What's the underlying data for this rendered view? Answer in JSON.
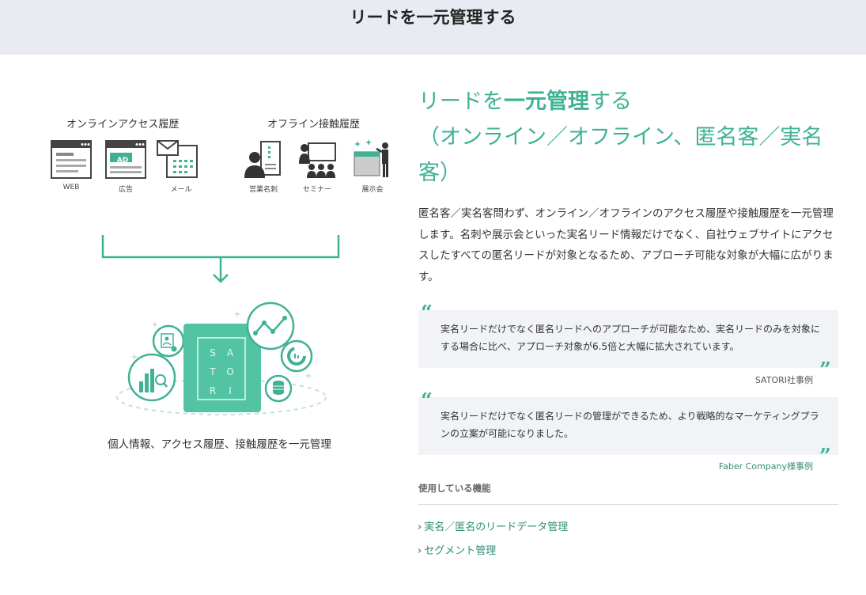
{
  "page": {
    "section_title": "リードを一元管理する"
  },
  "illustration": {
    "online_title": "オンラインアクセス履歴",
    "offline_title": "オフライン接触履歴",
    "online_items": [
      "WEB",
      "広告",
      "メール"
    ],
    "offline_items": [
      "営業名刺",
      "セミナー",
      "展示会"
    ],
    "ad_label": "AD",
    "logo_letters": [
      "S",
      "A",
      "T",
      "O",
      "R",
      "I"
    ],
    "caption": "個人情報、アクセス履歴、接触履歴を一元管理"
  },
  "content": {
    "headline_part1": "リードを",
    "headline_bold": "一元管理",
    "headline_part2": "する",
    "headline_line2": "（オンライン／オフライン、匿名客／実名",
    "headline_line3": "客）",
    "description": "匿名客／実名客問わず、オンライン／オフラインのアクセス履歴や接触履歴を一元管理します。名刺や展示会といった実名リード情報だけでなく、自社ウェブサイトにアクセスしたすべての匿名リードが対象となるため、アプローチ可能な対象が大幅に広がります。"
  },
  "quotes": [
    {
      "text": "実名リードだけでなく匿名リードへのアプローチが可能なため、実名リードのみを対象にする場合に比べ、アプローチ対象が6.5倍と大幅に拡大されています。",
      "source": "SATORI社事例"
    },
    {
      "text": "実名リードだけでなく匿名リードの管理ができるため、より戦略的なマーケティングプランの立案が可能になりました。",
      "source": "Faber Company様事例"
    }
  ],
  "features": {
    "title": "使用している機能",
    "links": [
      "実名／匿名のリードデータ管理",
      "セグメント管理"
    ]
  },
  "colors": {
    "accent": "#3fb295",
    "band": "#e8ebf1",
    "quote_bg": "#f1f3f6"
  }
}
